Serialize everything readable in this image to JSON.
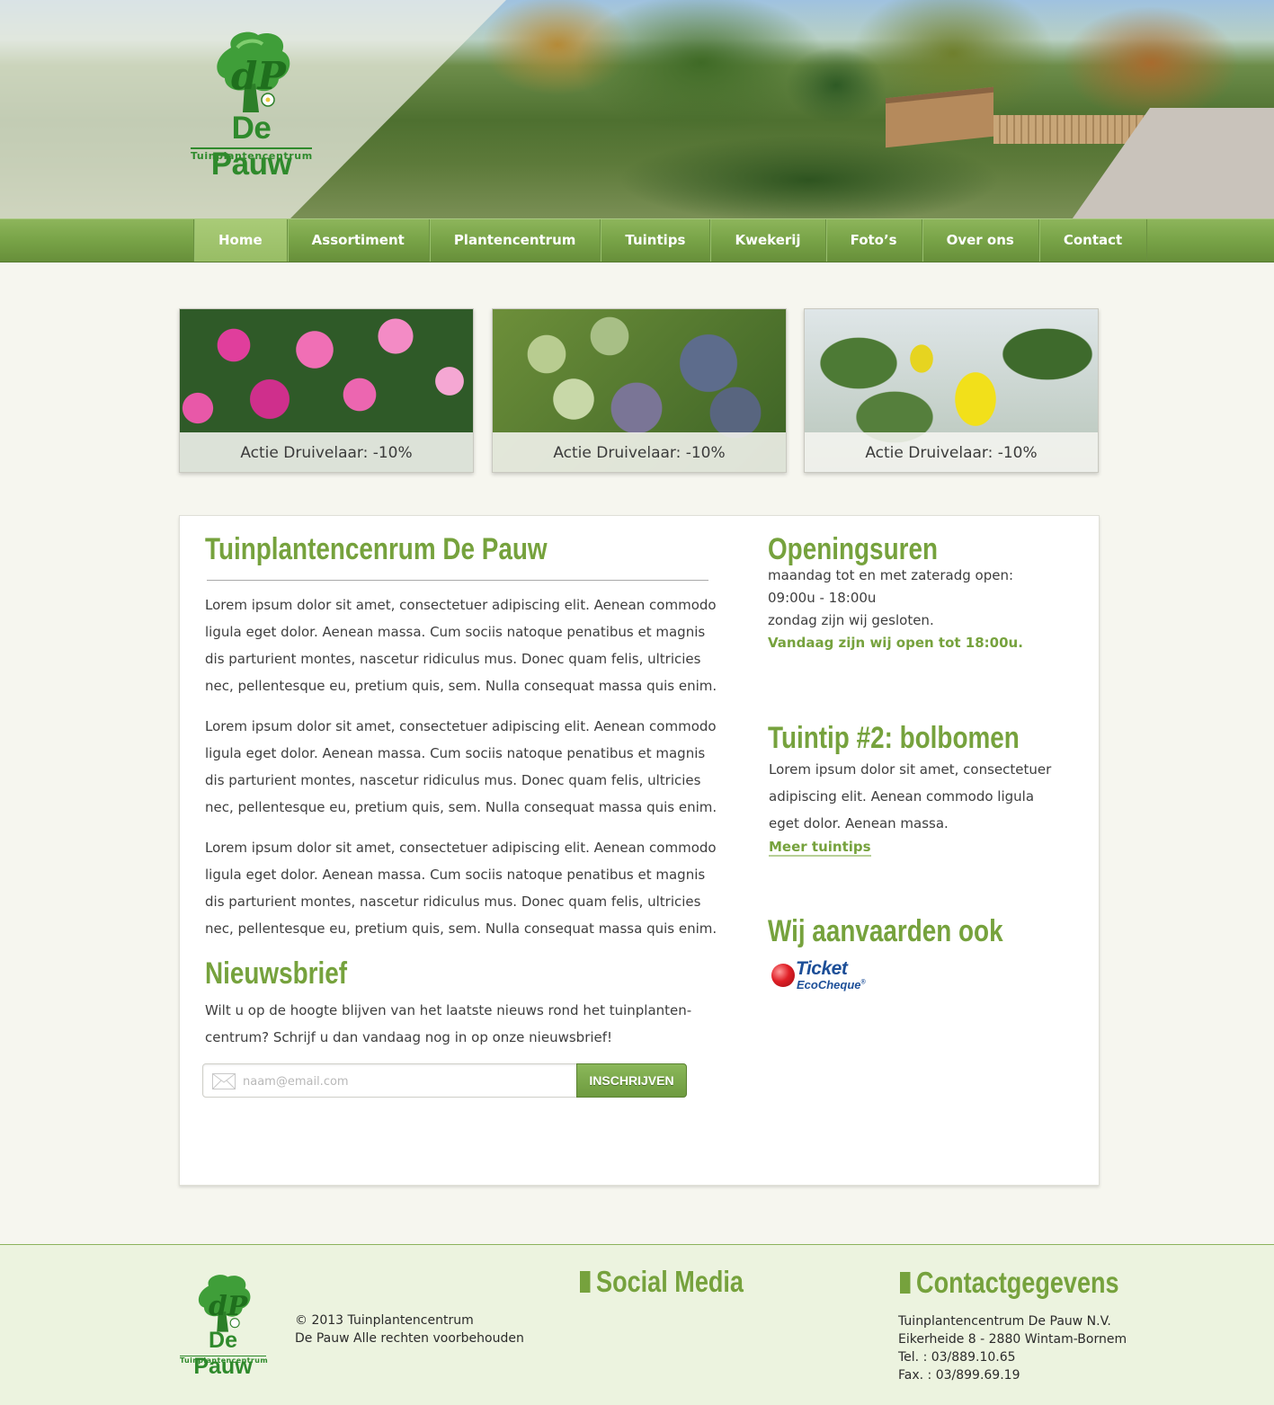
{
  "brand": {
    "name": "De Pauw",
    "tagline": "Tuinplantencentrum",
    "initials": "dP"
  },
  "colors": {
    "accent": "#76a23d",
    "nav_green": "#78a347",
    "logo_green": "#2f8a2c",
    "page_background": "#f6f6ef",
    "footer_background": "#ecf3df"
  },
  "nav": {
    "items": [
      {
        "label": "Home",
        "active": true
      },
      {
        "label": "Assortiment",
        "active": false
      },
      {
        "label": "Plantencentrum",
        "active": false
      },
      {
        "label": "Tuintips",
        "active": false
      },
      {
        "label": "Kwekerij",
        "active": false
      },
      {
        "label": "Foto’s",
        "active": false
      },
      {
        "label": "Over ons",
        "active": false
      },
      {
        "label": "Contact",
        "active": false
      }
    ]
  },
  "promos": [
    {
      "caption": "Actie Druivelaar: -10%",
      "image": "pink-flowers-photo"
    },
    {
      "caption": "Actie Druivelaar: -10%",
      "image": "blueberries-photo"
    },
    {
      "caption": "Actie Druivelaar: -10%",
      "image": "quince-photo"
    }
  ],
  "main": {
    "title": "Tuinplantencenrum De Pauw",
    "paragraphs": [
      "Lorem ipsum dolor sit amet, consectetuer adipiscing elit. Aenean commodo ligula eget dolor. Aenean massa. Cum sociis natoque penatibus et magnis dis parturient montes, nascetur ridiculus mus. Donec quam felis, ultricies nec, pellentesque eu, pretium quis, sem. Nulla consequat massa quis enim.",
      "Lorem ipsum dolor sit amet, consectetuer adipiscing elit. Aenean commodo ligula eget dolor. Aenean massa. Cum sociis natoque penatibus et magnis dis parturient montes, nascetur ridiculus mus. Donec quam felis, ultricies nec, pellentesque eu, pretium quis, sem. Nulla consequat massa quis enim.",
      "Lorem ipsum dolor sit amet, consectetuer adipiscing elit. Aenean commodo ligula eget dolor. Aenean massa. Cum sociis natoque penatibus et magnis dis parturient montes, nascetur ridiculus mus. Donec quam felis, ultricies nec, pellentesque eu, pretium quis, sem. Nulla consequat massa quis enim."
    ]
  },
  "newsletter": {
    "title": "Nieuwsbrief",
    "text": "Wilt u op de hoogte blijven van het laatste nieuws rond het tuinplanten-centrum? Schrijf u dan vandaag nog in op onze nieuwsbrief!",
    "placeholder": "naam@email.com",
    "value": "",
    "button_label": "INSCHRIJVEN",
    "icon": "envelope-icon"
  },
  "opening_hours": {
    "title": "Openingsuren",
    "line1": "maandag tot en met zateradg open:",
    "line2": "09:00u - 18:00u",
    "line3": "zondag zijn wij gesloten.",
    "today": "Vandaag zijn wij open tot 18:00u."
  },
  "tip": {
    "title": "Tuintip #2: bolbomen",
    "text": "Lorem ipsum dolor sit amet, consectetuer adipiscing elit. Aenean commodo ligula eget dolor. Aenean massa.",
    "link_label": "Meer tuintips"
  },
  "accept": {
    "title": "Wij aanvaarden ook",
    "logo_main": "Ticket",
    "logo_sub": "EcoCheque",
    "logo_mark": "®"
  },
  "footer": {
    "copyright_line1": "© 2013 Tuinplantencentrum",
    "copyright_line2": "De Pauw Alle rechten voorbehouden",
    "social_title": "Social Media",
    "contact_title": "Contactgegevens",
    "contact_lines": [
      "Tuinplantencentrum De Pauw N.V.",
      "Eikerheide 8 - 2880 Wintam-Bornem",
      "Tel. : 03/889.10.65",
      "Fax. : 03/899.69.19"
    ]
  }
}
